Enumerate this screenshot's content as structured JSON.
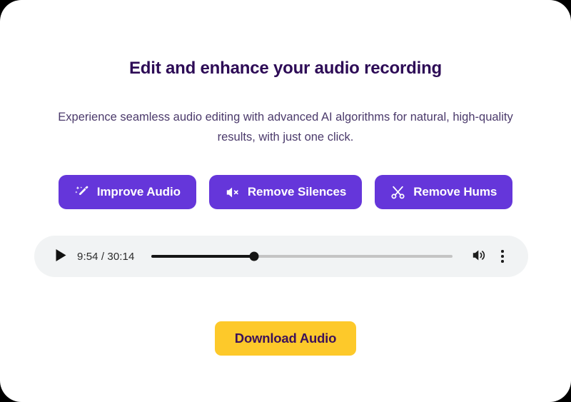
{
  "card": {
    "background": "#ffffff",
    "corner_radius_px": 30
  },
  "heading": {
    "title": "Edit and enhance your audio recording",
    "title_color": "#2d0b56",
    "subtitle": "Experience seamless audio editing with advanced AI algorithms for natural, high-quality results, with just one click.",
    "subtitle_color": "#4b3a6b"
  },
  "actions": {
    "accent_color": "#6536da",
    "buttons": [
      {
        "label": "Improve Audio",
        "icon": "magic-wand-sparkles-icon"
      },
      {
        "label": "Remove Silences",
        "icon": "speaker-mute-icon"
      },
      {
        "label": "Remove Hums",
        "icon": "scissors-icon"
      }
    ]
  },
  "player": {
    "background": "#f1f3f4",
    "play_icon": "play-icon",
    "current_time": "9:54",
    "duration": "30:14",
    "time_display": "9:54 / 30:14",
    "progress_percent": 34,
    "track_color": "#c4c4c4",
    "fill_color": "#151515",
    "volume_icon": "volume-high-icon",
    "more_icon": "more-vertical-icon"
  },
  "download": {
    "label": "Download Audio",
    "background": "#fdc92a",
    "text_color": "#3d1259"
  }
}
